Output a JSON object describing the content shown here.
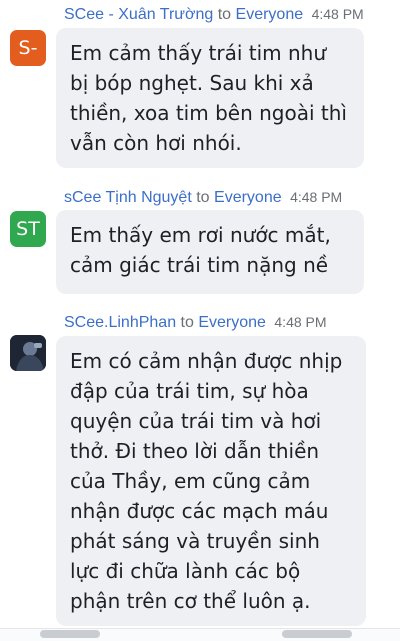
{
  "messages": [
    {
      "sender": "SCee - Xuân Trường",
      "to": "to",
      "audience": "Everyone",
      "time": "4:48 PM",
      "avatar_text": "S-",
      "avatar_color": "#e35d1f",
      "text": "Em cảm thấy trái tim như bị bóp nghẹt. Sau khi xả thiền, xoa tim bên ngoài thì vẫn còn hơi nhói."
    },
    {
      "sender": "sCee Tịnh Nguyệt",
      "to": "to",
      "audience": "Everyone",
      "time": "4:48 PM",
      "avatar_text": "ST",
      "avatar_color": "#2fa84f",
      "text": "Em thấy em rơi nước mắt, cảm giác trái tim nặng nề"
    },
    {
      "sender": "SCee.LinhPhan",
      "to": "to",
      "audience": "Everyone",
      "time": "4:48 PM",
      "avatar_text": "",
      "avatar_color": "#1f2633",
      "text": "Em có cảm nhận được nhịp đập của trái tim, sự hòa quyện của trái tim và hơi thở. Đi theo lời dẫn thiền của Thầy, em cũng cảm nhận được các mạch máu phát sáng và truyền sinh lực đi chữa lành các bộ phận trên cơ thể luôn ạ."
    }
  ]
}
